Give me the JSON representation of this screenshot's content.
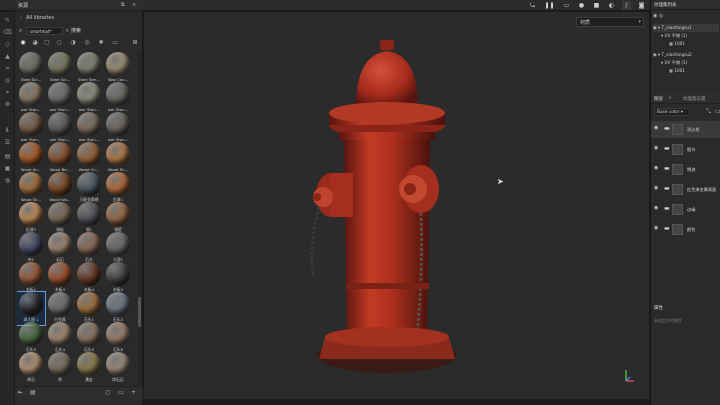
{
  "assets_panel": {
    "title": "资源",
    "breadcrumb": "All libraries",
    "search": {
      "value": "smartmat*",
      "clear": "×",
      "button": "搜索"
    },
    "filter_icons": [
      "circle-filled-icon",
      "sphere-icon",
      "square-icon",
      "brush-icon",
      "half-circle-icon",
      "texture-icon",
      "gear-icon",
      "image-icon",
      "grid-icon"
    ],
    "materials": [
      {
        "label": "Steel Scr...",
        "color": "#6f6f66"
      },
      {
        "label": "Steel Scr...",
        "color": "#7a7a62"
      },
      {
        "label": "Steel Tam...",
        "color": "#808070"
      },
      {
        "label": "Wax Can...",
        "color": "#9c8e74"
      },
      {
        "label": "wer Ston...",
        "color": "#8a7a66"
      },
      {
        "label": "wer Ston...",
        "color": "#6e6e6e"
      },
      {
        "label": "wer Ston...",
        "color": "#8c8c7c"
      },
      {
        "label": "wer Ston...",
        "color": "#6a6a66"
      },
      {
        "label": "wer Ston...",
        "color": "#7a5e48"
      },
      {
        "label": "wer Ston...",
        "color": "#5c5c5c"
      },
      {
        "label": "wer Ston...",
        "color": "#7c6d5e"
      },
      {
        "label": "wer Ston...",
        "color": "#6a6662"
      },
      {
        "label": "Wood An...",
        "color": "#a85a28"
      },
      {
        "label": "Wood Be...",
        "color": "#8a5430"
      },
      {
        "label": "Wood Ch...",
        "color": "#96643a"
      },
      {
        "label": "Wood Sh...",
        "color": "#b07a48"
      },
      {
        "label": "Wood Sh...",
        "color": "#a3703e"
      },
      {
        "label": "Wood Wa...",
        "color": "#7e4a26"
      },
      {
        "label": "万能金属锈",
        "color": "#4a5a62"
      },
      {
        "label": "旧漆1",
        "color": "#b26a3a"
      },
      {
        "label": "旧漆2",
        "color": "#c08a58"
      },
      {
        "label": "地板",
        "color": "#7a6a56"
      },
      {
        "label": "墙1",
        "color": "#54545a"
      },
      {
        "label": "墙壁",
        "color": "#9a6a48"
      },
      {
        "label": "布1",
        "color": "#4a4a6a"
      },
      {
        "label": "岩石",
        "color": "#9a8570"
      },
      {
        "label": "石头",
        "color": "#8a6a56"
      },
      {
        "label": "大理1",
        "color": "#6a6a6e"
      },
      {
        "label": "木板1",
        "color": "#9a5a3a"
      },
      {
        "label": "木板3",
        "color": "#a0502c"
      },
      {
        "label": "木板4",
        "color": "#6a3a26"
      },
      {
        "label": "木板5",
        "color": "#444444"
      },
      {
        "label": "润大理 1",
        "color": "#2e2e30"
      },
      {
        "label": "白金属",
        "color": "#6e6e70"
      },
      {
        "label": "石头1",
        "color": "#a0703e"
      },
      {
        "label": "石头2",
        "color": "#6e7a86"
      },
      {
        "label": "石头3",
        "color": "#4a6a40"
      },
      {
        "label": "石头4",
        "color": "#a08870"
      },
      {
        "label": "石头5",
        "color": "#8a7464"
      },
      {
        "label": "石头6",
        "color": "#9a7e6a"
      },
      {
        "label": "砖石",
        "color": "#b09070"
      },
      {
        "label": "砖",
        "color": "#7a6e62"
      },
      {
        "label": "黄金",
        "color": "#8a7a4a"
      },
      {
        "label": "岗石石",
        "color": "#9a8a7a"
      }
    ],
    "selected_index": 32
  },
  "viewport": {
    "mode_select": "材质",
    "mode_arrow": "▾"
  },
  "right_panel": {
    "texture_set_list": {
      "title": "纹理集列表"
    },
    "texture_sets": [
      {
        "name": "T_xiaofangsu1",
        "uv": "UV 平铺 (1)",
        "tile": "1001"
      },
      {
        "name": "T_xiaofangsu2",
        "uv": "UV 平铺 (1)",
        "tile": "1001"
      }
    ],
    "layers_tab": "图层",
    "texture_set_settings_tab": "纹理集设置",
    "channel": "Base color",
    "layers": [
      {
        "name": "消火栓",
        "selected": true
      },
      {
        "name": "细节",
        "selected": false
      },
      {
        "name": "锈迹",
        "selected": false
      },
      {
        "name": "红色漆金属表面",
        "selected": false
      },
      {
        "name": "边缘",
        "selected": false
      },
      {
        "name": "颜色",
        "selected": false
      }
    ],
    "properties": {
      "title": "属性",
      "hint": "未选定任何属性"
    }
  },
  "colors": {
    "hydrant_red": "#b0301e",
    "hydrant_dark": "#6a1a12",
    "selection": "#6a9bd8"
  }
}
